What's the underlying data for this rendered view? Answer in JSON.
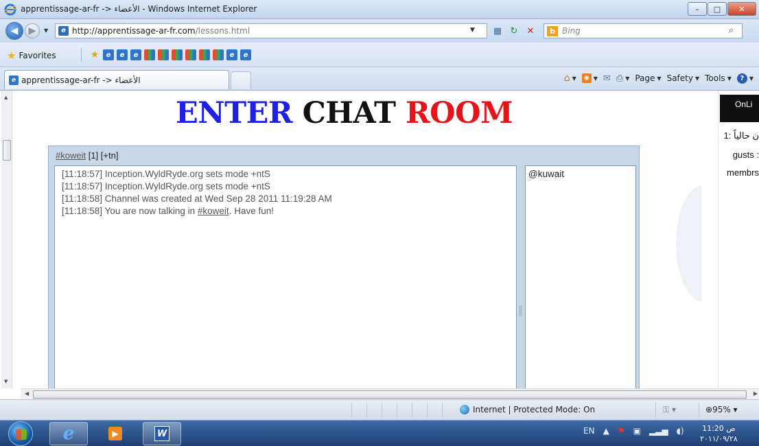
{
  "window": {
    "title": "apprentissage-ar-fr -> الأعضاء - Windows Internet Explorer",
    "buttons": {
      "minimize": "–",
      "maximize": "□",
      "close": "✕"
    }
  },
  "address": {
    "url_domain": "http://apprentissage-ar-fr.com",
    "url_path": "/lessons.html",
    "search_placeholder": "Bing"
  },
  "favorites": {
    "label": "Favorites"
  },
  "tab": {
    "label": "apprentissage-ar-fr -> الأعضاء"
  },
  "commands": {
    "page": "Page",
    "safety": "Safety",
    "tools": "Tools"
  },
  "page": {
    "heading": {
      "word1": "ENTER",
      "word2": "CHAT",
      "word3": "ROOM"
    },
    "colors": {
      "word1": "#1f1fe6",
      "word2": "#111111",
      "word3": "#e5141a"
    }
  },
  "chat": {
    "channel": "#koweit",
    "header_rest": "[1] [+tn]",
    "messages": [
      "[11:18:57] Inception.WyldRyde.org sets mode +ntS",
      "[11:18:57] Inception.WyldRyde.org sets mode +ntS",
      "[11:18:58] Channel was created at Wed Sep 28 2011 11:19:28 AM"
    ],
    "last_message": {
      "prefix": "[11:18:58] You are now talking in ",
      "link": "#koweit",
      "suffix": ". Have fun!"
    },
    "users": [
      "@kuwait"
    ]
  },
  "right_panel": {
    "online": "OnLi",
    "line1": "ن حالياً :1",
    "line2": "gusts :",
    "line3": "membrs"
  },
  "status": {
    "zone": "Internet | Protected Mode: On",
    "zoom": "95%"
  },
  "taskbar": {
    "lang": "EN",
    "clock_time": "11:20 ص",
    "clock_date": "٢٠١١/٠٩/٢٨"
  }
}
